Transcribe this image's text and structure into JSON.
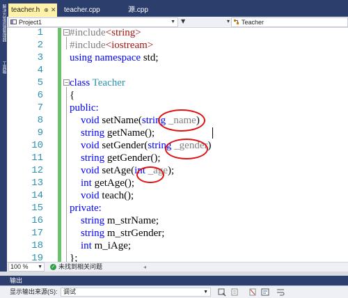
{
  "side_strip": {
    "labels": [
      "解决方案资源管理器",
      "工具箱"
    ]
  },
  "tabs": [
    {
      "label": "teacher.h",
      "active": true,
      "pin": "⊕",
      "close": "✕"
    },
    {
      "label": "teacher.cpp",
      "active": false
    },
    {
      "label": "源.cpp",
      "active": false
    }
  ],
  "nav": {
    "project": "Project1",
    "member": "Teacher"
  },
  "editor": {
    "lines": [
      {
        "n": "1"
      },
      {
        "n": "2"
      },
      {
        "n": "3"
      },
      {
        "n": "4"
      },
      {
        "n": "5"
      },
      {
        "n": "6"
      },
      {
        "n": "7"
      },
      {
        "n": "8"
      },
      {
        "n": "9"
      },
      {
        "n": "10"
      },
      {
        "n": "11"
      },
      {
        "n": "12"
      },
      {
        "n": "13"
      },
      {
        "n": "14"
      },
      {
        "n": "15"
      },
      {
        "n": "16"
      },
      {
        "n": "17"
      },
      {
        "n": "18"
      },
      {
        "n": "19"
      }
    ],
    "code": {
      "l1_kw": "#include",
      "l1_str": "<string>",
      "l2_kw": "#include",
      "l2_str": "<iostream>",
      "l3_using": "using",
      "l3_namespace": "namespace",
      "l3_rest": " std;",
      "l5_class": "class",
      "l5_name": "Teacher",
      "l6": "{",
      "l7": "public:",
      "l8_void": "void",
      "l8_fn": " setName(",
      "l8_type": "string",
      "l8_param": " _name",
      "l8_end": ")",
      "l9_type": "string",
      "l9_rest": " getName();",
      "l10_void": "void",
      "l10_fn": " setGender(",
      "l10_type": "string",
      "l10_param": " _gender",
      "l10_end": ")",
      "l11_type": "string",
      "l11_rest": " getGender();",
      "l12_void": "void",
      "l12_fn": " setAge(",
      "l12_type": "int",
      "l12_param": " _age",
      "l12_end": ");",
      "l13_type": "int",
      "l13_rest": " getAge();",
      "l14_void": "void",
      "l14_rest": " teach();",
      "l15": "private:",
      "l16_type": "string",
      "l16_rest": " m_strName;",
      "l17_type": "string",
      "l17_rest": " m_strGender;",
      "l18_type": "int",
      "l18_rest": " m_iAge;",
      "l19": "};"
    }
  },
  "status": {
    "zoom": "100 %",
    "issues": "未找到相关问题"
  },
  "output": {
    "title": "输出",
    "source_label": "显示输出来源(S):",
    "source_value": "调试"
  },
  "colors": {
    "keyword": "#0000ff",
    "preprocessor": "#808080",
    "string": "#a31515",
    "class_name": "#2b91af",
    "annotation_circle": "#e01010",
    "change_bar": "#6bc26b"
  }
}
